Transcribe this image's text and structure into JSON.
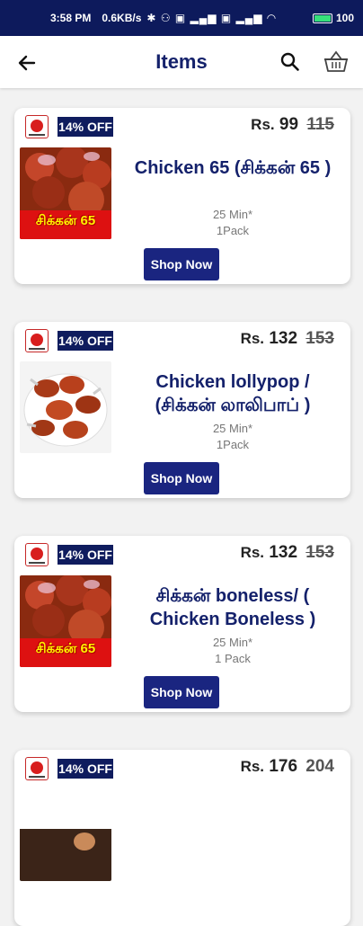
{
  "status_bar": {
    "time": "3:58 PM",
    "data_speed": "0.6KB/s",
    "symbols": "✱ ⚇ ▣ ▂▄▆ ▣ ▂▄▆ ◠",
    "battery": "100"
  },
  "appbar": {
    "title": "Items"
  },
  "items": [
    {
      "discount": "14% OFF",
      "currency": "Rs.",
      "price": "99",
      "old_price": "115",
      "name": "Chicken 65 (சிக்கன் 65 )",
      "time": "25 Min*",
      "pack": "1Pack",
      "shop_label": "Shop Now",
      "thumb_label": "சிக்கன் 65"
    },
    {
      "discount": "14% OFF",
      "currency": "Rs.",
      "price": "132",
      "old_price": "153",
      "name": "Chicken lollypop / (சிக்கன் லாலிபாப் )",
      "time": "25 Min*",
      "pack": "1Pack",
      "shop_label": "Shop Now",
      "thumb_label": ""
    },
    {
      "discount": "14% OFF",
      "currency": "Rs.",
      "price": "132",
      "old_price": "153",
      "name": "சிக்கன் boneless/ ( Chicken Boneless )",
      "time": "25 Min*",
      "pack": "1 Pack",
      "shop_label": "Shop Now",
      "thumb_label": "சிக்கன் 65"
    },
    {
      "discount": "14% OFF",
      "currency": "Rs.",
      "price": "176",
      "old_price": "204",
      "name": "",
      "time": "",
      "pack": "",
      "shop_label": "",
      "thumb_label": ""
    }
  ],
  "colors": {
    "brand_navy": "#14216b",
    "button": "#1a2580",
    "status_bar": "#0d1a5c"
  }
}
